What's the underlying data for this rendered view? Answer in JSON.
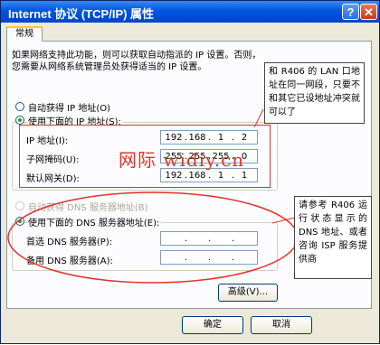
{
  "window": {
    "title": "Internet 协议 (TCP/IP) 属性",
    "help": "?",
    "close": "✕"
  },
  "tab": "常规",
  "description_line1": "如果网络支持此功能，则可以获取自动指派的 IP 设置。否则，",
  "description_line2": "您需要从网络系统管理员处获得适当的 IP 设置。",
  "ip_auto": "自动获得 IP 地址(O)",
  "ip_manual": "使用下面的 IP 地址(S):",
  "ip_fields": [
    {
      "label": "IP 地址(I):",
      "octets": [
        "192",
        "168",
        "1",
        "2"
      ]
    },
    {
      "label": "子网掩码(U):",
      "octets": [
        "255",
        "255",
        "255",
        "0"
      ]
    },
    {
      "label": "默认网关(D):",
      "octets": [
        "192",
        "168",
        "1",
        "1"
      ]
    }
  ],
  "dns_auto": "自动获得 DNS 服务器地址(B)",
  "dns_manual": "使用下面的 DNS 服务器地址(E):",
  "dns_fields": [
    {
      "label": "首选 DNS 服务器(P):"
    },
    {
      "label": "备用 DNS 服务器(A):"
    }
  ],
  "buttons": {
    "advanced": "高级(V)...",
    "ok": "确定",
    "cancel": "取消"
  },
  "note1": "和 R406 的 LAN 口地址在同一网段，只要不和其它已设地址冲突就可以了",
  "note2": "请参考 R406 运行状态显示的 DNS 地址、或者咨询 ISP 服务提供商",
  "watermark": "网际 widiy.cn",
  "colors": {
    "title_bar": "#0054e3",
    "annotation": "#e0332a",
    "radio_selected": "#21a121"
  }
}
